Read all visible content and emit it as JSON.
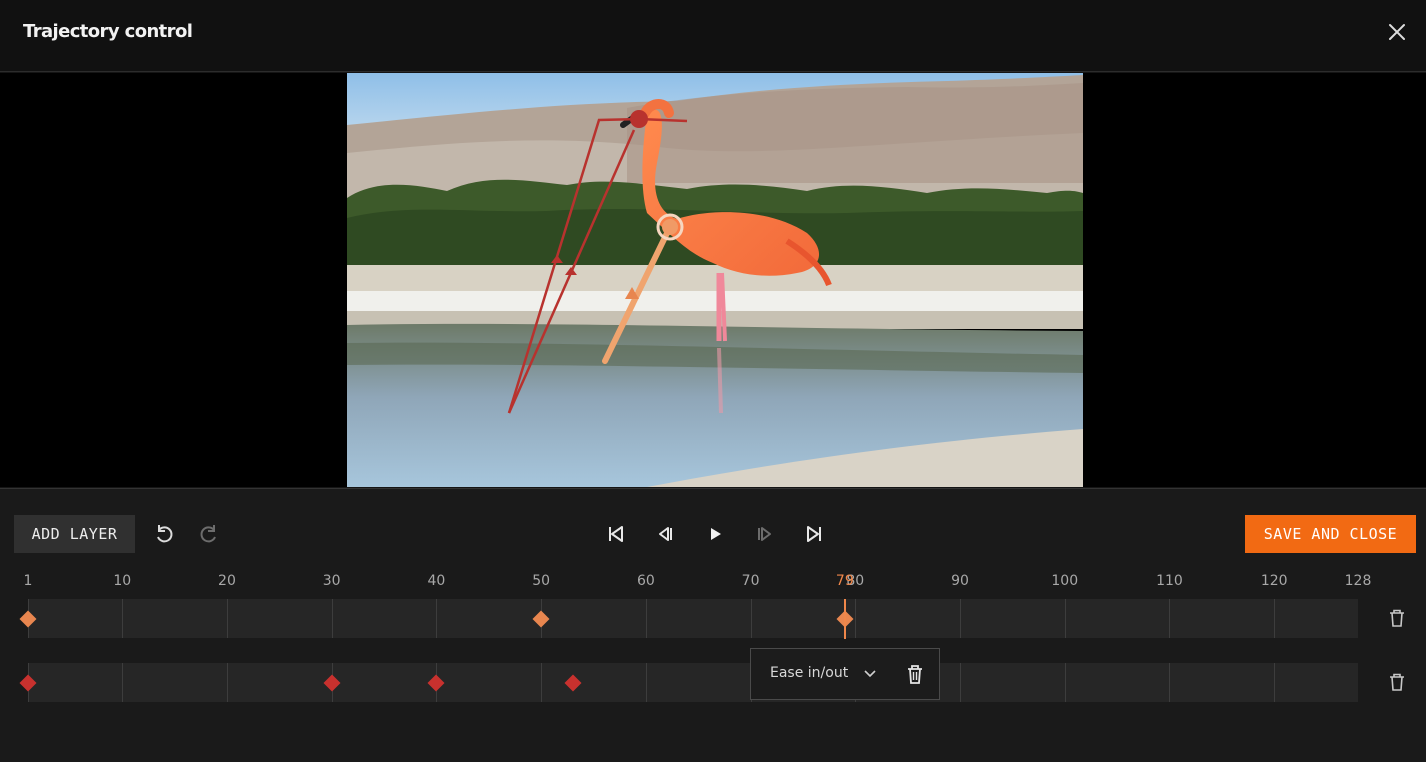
{
  "window": {
    "title": "Trajectory control"
  },
  "icons": {
    "close": "close-icon",
    "undo": "undo-icon",
    "redo": "redo-icon",
    "skip_start": "skip-to-start-icon",
    "step_back": "step-back-icon",
    "play": "play-icon",
    "step_forward": "step-forward-icon",
    "skip_end": "skip-to-end-icon",
    "delete": "trash-icon",
    "dropdown": "chevron-down-icon"
  },
  "toolbar": {
    "add_layer_label": "ADD LAYER",
    "save_close_label": "SAVE AND CLOSE",
    "redo_enabled": false,
    "step_forward_enabled": false
  },
  "timeline": {
    "total_frames": 128,
    "current_frame": 79,
    "current_frame_label": "79",
    "ticks": [
      "1",
      "10",
      "20",
      "30",
      "40",
      "50",
      "60",
      "70",
      "80",
      "90",
      "100",
      "110",
      "120",
      "128"
    ],
    "tracks": [
      {
        "name": "layer-1",
        "color": "#e8864f",
        "keyframes": [
          1,
          50,
          79
        ]
      },
      {
        "name": "layer-2",
        "color": "#c8312e",
        "keyframes": [
          1,
          30,
          40,
          53
        ]
      }
    ]
  },
  "ease_menu": {
    "label": "Ease in/out"
  },
  "colors": {
    "accent": "#f26a13",
    "track_one": "#e8864f",
    "track_two": "#c8312e",
    "playhead": "#f0874a"
  }
}
